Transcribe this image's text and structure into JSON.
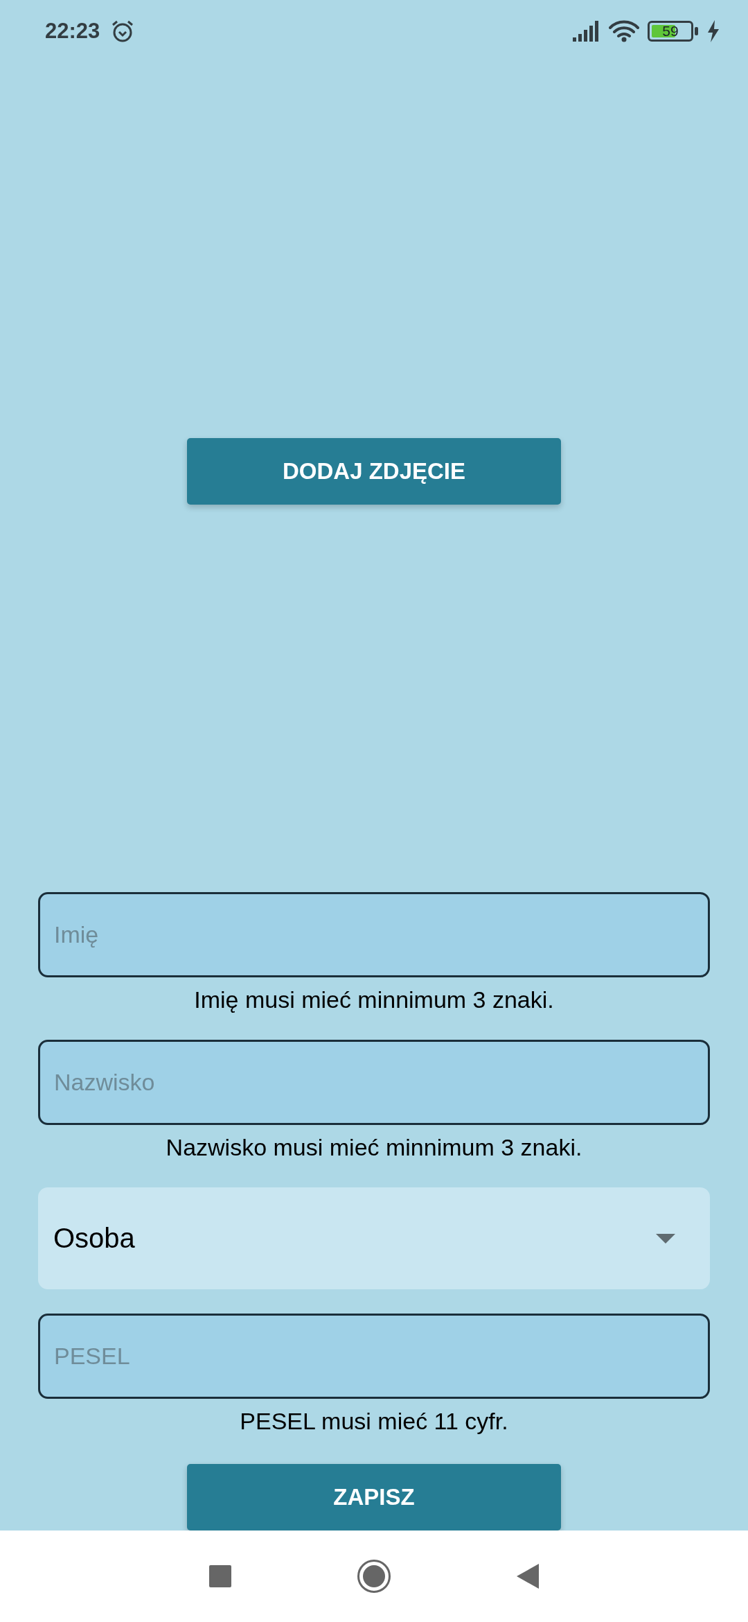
{
  "status_bar": {
    "time": "22:23",
    "battery": "59"
  },
  "photo_button": "DODAJ ZDJĘCIE",
  "fields": [
    {
      "kind": "text",
      "placeholder": "Imię",
      "error": "Imię musi mieć minnimum 3 znaki."
    },
    {
      "kind": "text",
      "placeholder": "Nazwisko",
      "error": "Nazwisko musi mieć minnimum 3 znaki."
    },
    {
      "kind": "dropdown",
      "value": "Osoba"
    },
    {
      "kind": "text",
      "placeholder": "PESEL",
      "error": "PESEL musi mieć 11 cyfr."
    }
  ],
  "save_button": "ZAPISZ"
}
